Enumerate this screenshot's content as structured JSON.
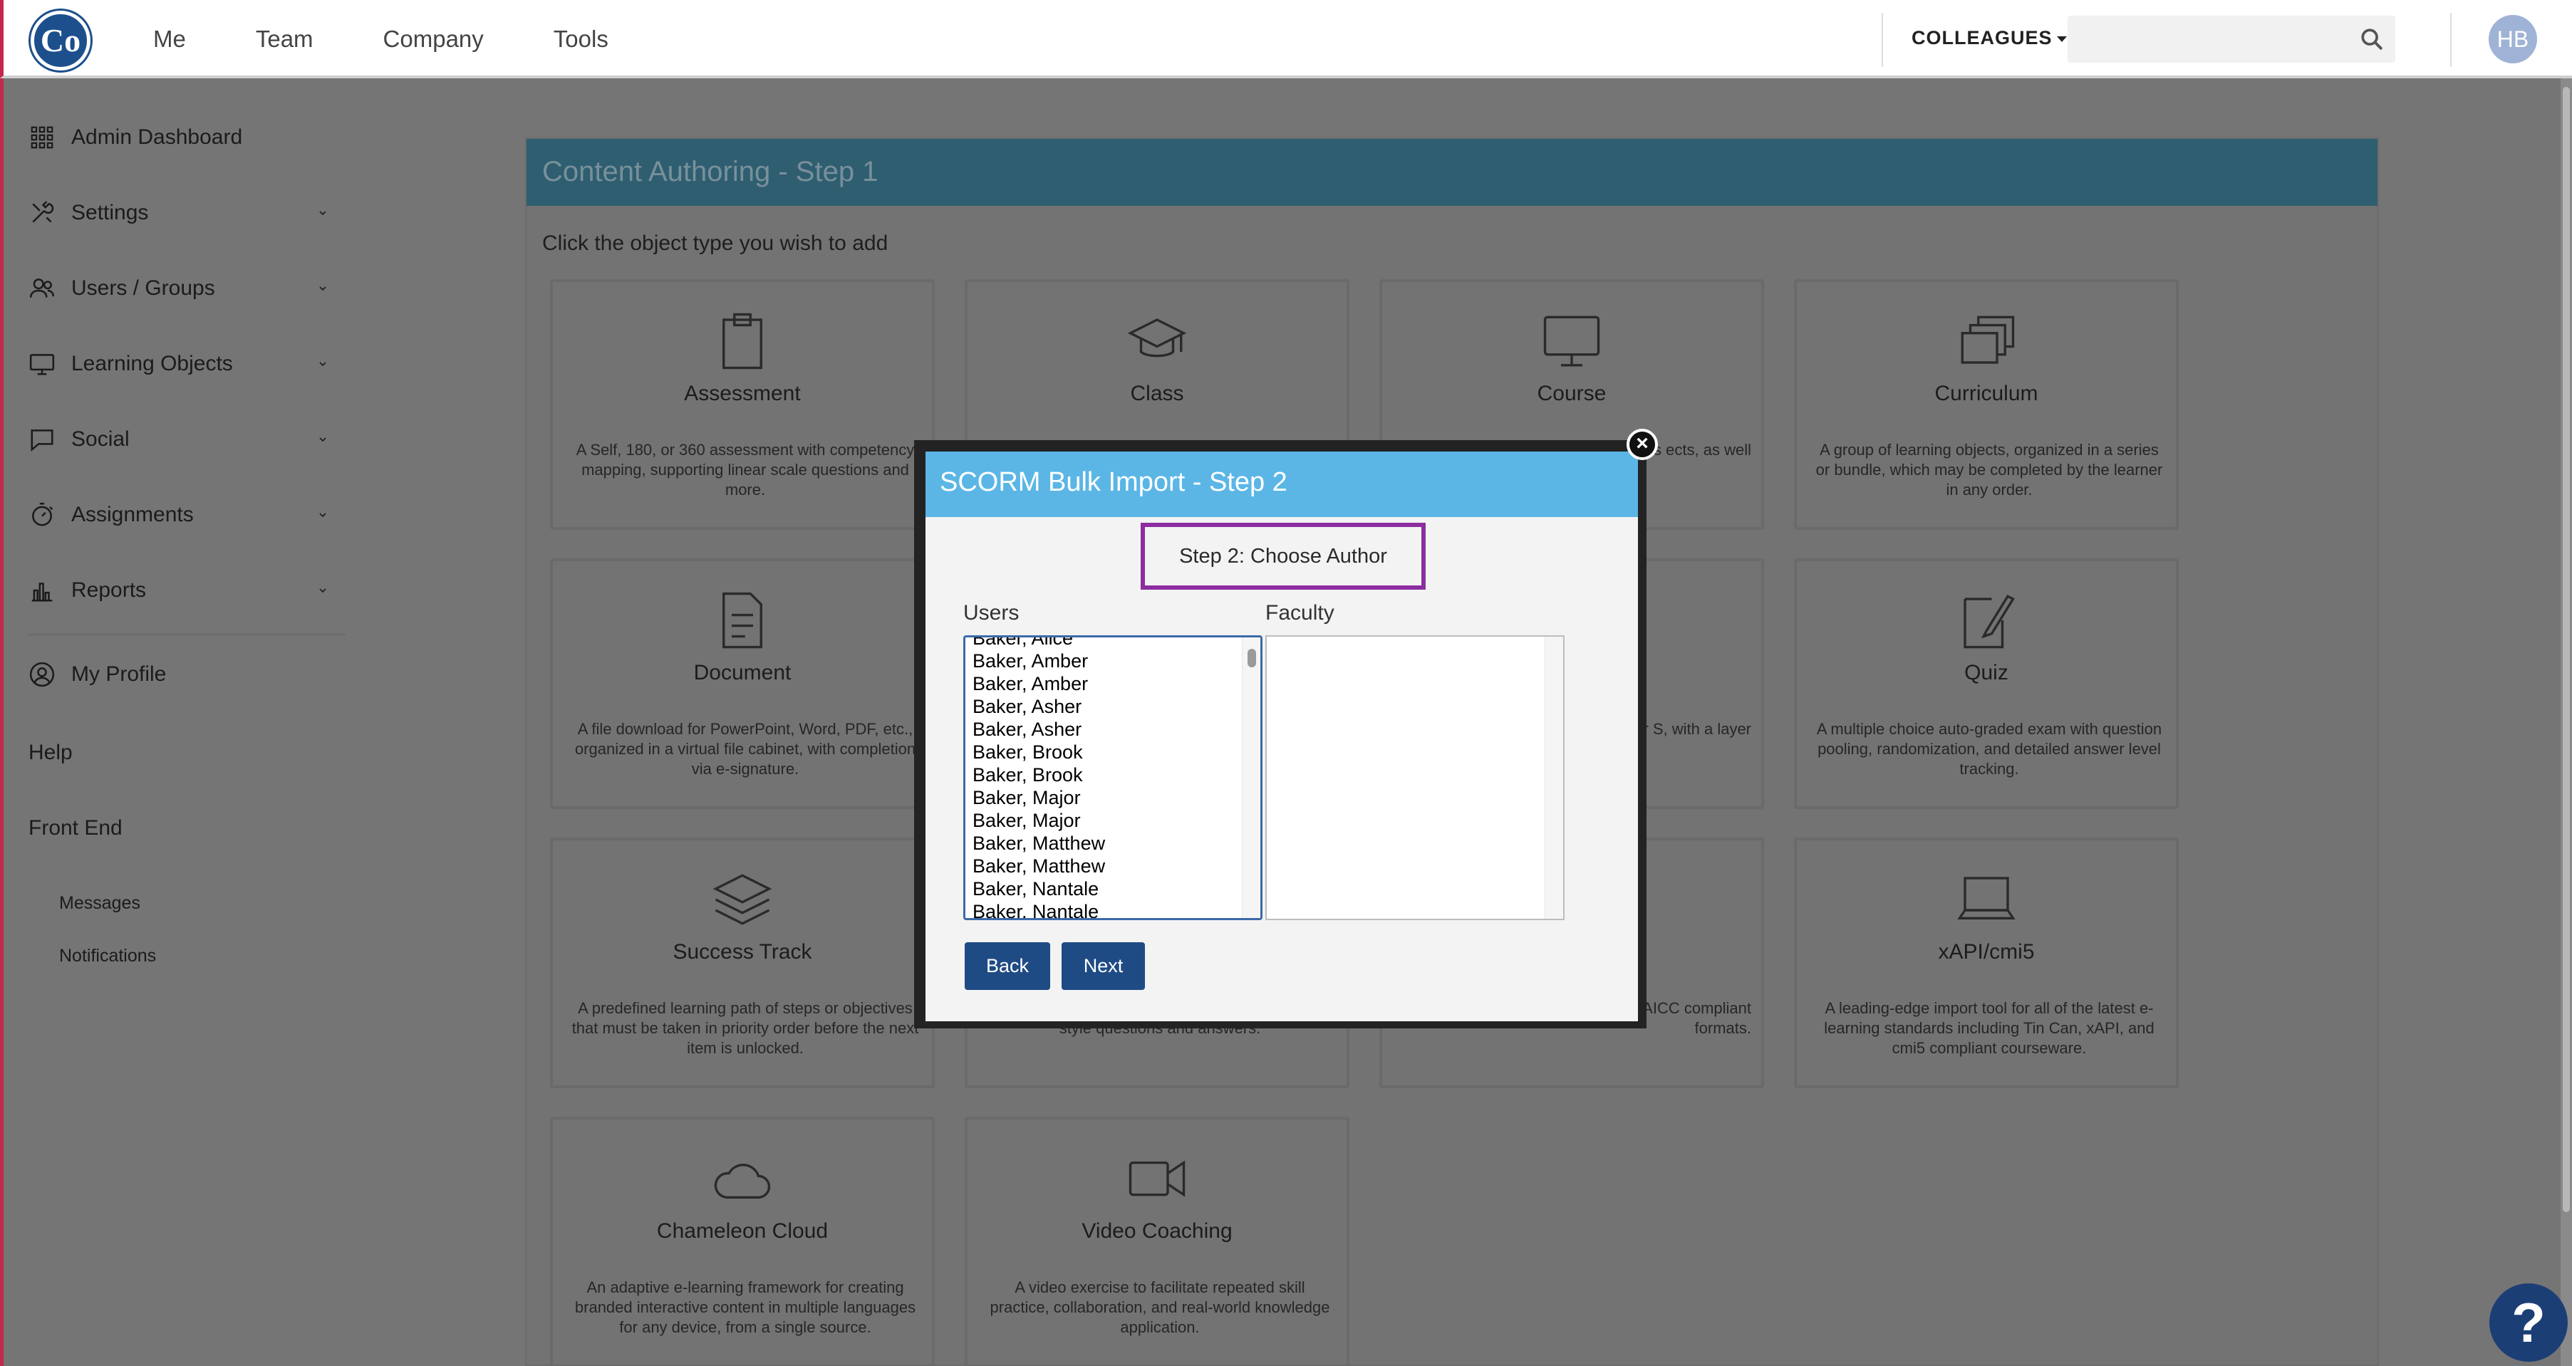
{
  "topnav": {
    "items": [
      "Me",
      "Team",
      "Company",
      "Tools"
    ],
    "colleagues_label": "COLLEAGUES",
    "search_placeholder": "",
    "avatar_initials": "HB",
    "logo_text": "Co"
  },
  "sidebar": {
    "items": [
      {
        "label": "Admin Dashboard",
        "icon": "grid-icon"
      },
      {
        "label": "Settings",
        "icon": "tools-icon"
      },
      {
        "label": "Users / Groups",
        "icon": "users-icon"
      },
      {
        "label": "Learning Objects",
        "icon": "monitor-icon"
      },
      {
        "label": "Social",
        "icon": "chat-icon"
      },
      {
        "label": "Assignments",
        "icon": "stopwatch-icon"
      },
      {
        "label": "Reports",
        "icon": "bar-chart-icon"
      }
    ],
    "profile": "My Profile",
    "help": "Help",
    "front_end": "Front End",
    "sub_items": [
      "Messages",
      "Notifications"
    ]
  },
  "panel": {
    "title": "Content Authoring - Step 1",
    "subtitle": "Click the object type you wish to add",
    "cards": [
      {
        "title": "Assessment",
        "desc": "A Self, 180, or 360 assessment with competency mapping, supporting linear scale questions and more.",
        "icon": "clipboard-icon"
      },
      {
        "title": "Class",
        "desc": "",
        "icon": "graduation-cap-icon"
      },
      {
        "title": "Course",
        "desc": "ore steps ects, as well",
        "icon": "monitor-icon"
      },
      {
        "title": "Curriculum",
        "desc": "A group of learning objects, organized in a series or bundle, which may be completed by the learner in any order.",
        "icon": "stack-icon"
      },
      {
        "title": "Document",
        "desc": "A file download for PowerPoint, Word, PDF, etc., organized in a virtual file cabinet, with completion via e-signature.",
        "icon": "document-icon"
      },
      {
        "title": "",
        "desc": "",
        "icon": ""
      },
      {
        "title": "",
        "desc": "anet URL's or S, with a layer",
        "icon": ""
      },
      {
        "title": "Quiz",
        "desc": "A multiple choice auto-graded exam with question pooling, randomization, and detailed answer level tracking.",
        "icon": "pencil-icon"
      },
      {
        "title": "Success Track",
        "desc": "A predefined learning path of steps or objectives that must be taken in priority order before the next item is unlocked.",
        "icon": "layers-icon"
      },
      {
        "title": "",
        "desc": "style questions and answers.",
        "icon": ""
      },
      {
        "title": "",
        "desc": "industry veloped in SCORM or AICC compliant formats.",
        "icon": ""
      },
      {
        "title": "xAPI/cmi5",
        "desc": "A leading-edge import tool for all of the latest e-learning standards including Tin Can, xAPI, and cmi5 compliant courseware.",
        "icon": "laptop-icon"
      },
      {
        "title": "Chameleon Cloud",
        "desc": "An adaptive e-learning framework for creating branded interactive content in multiple languages for any device, from a single source.",
        "icon": "cloud-icon"
      },
      {
        "title": "Video Coaching",
        "desc": "A video exercise to facilitate repeated skill practice, collaboration, and real-world knowledge application.",
        "icon": "video-camera-icon"
      }
    ]
  },
  "modal": {
    "title": "SCORM Bulk Import - Step 2",
    "step_label": "Step 2: Choose Author",
    "users_label": "Users",
    "faculty_label": "Faculty",
    "users": [
      "Baker, Alice",
      "Baker, Amber",
      "Baker, Amber",
      "Baker, Asher",
      "Baker, Asher",
      "Baker, Brook",
      "Baker, Brook",
      "Baker, Major",
      "Baker, Major",
      "Baker, Matthew",
      "Baker, Matthew",
      "Baker, Nantale",
      "Baker, Nantale"
    ],
    "faculty": [],
    "back_label": "Back",
    "next_label": "Next",
    "close_glyph": "×"
  },
  "help_glyph": "?"
}
